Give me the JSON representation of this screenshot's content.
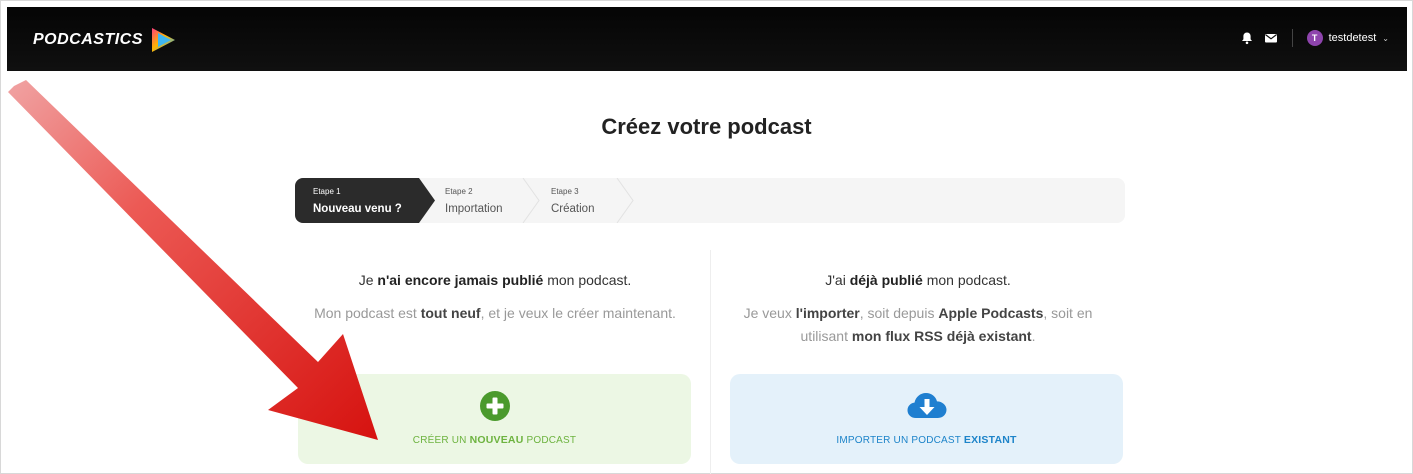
{
  "header": {
    "logo_text": "PODCASTICS",
    "notifications_icon": "bell-icon",
    "messages_icon": "envelope-icon",
    "avatar_initial": "T",
    "username": "testdetest",
    "caret": "⌄"
  },
  "page_title": "Créez votre podcast",
  "steps": [
    {
      "number": "Etape 1",
      "label": "Nouveau venu ?",
      "active": true
    },
    {
      "number": "Etape 2",
      "label": "Importation",
      "active": false
    },
    {
      "number": "Etape 3",
      "label": "Création",
      "active": false
    }
  ],
  "left_option": {
    "head_pre": "Je ",
    "head_bold": "n'ai encore jamais publié",
    "head_post": " mon podcast.",
    "sub_pre": "Mon podcast est ",
    "sub_bold": "tout neuf",
    "sub_post": ", et je veux le créer maintenant.",
    "button_icon": "plus-circle-icon",
    "button_pre": "CRÉER UN ",
    "button_bold": "NOUVEAU",
    "button_post": " PODCAST"
  },
  "right_option": {
    "head_pre": "J'ai ",
    "head_bold": "déjà publié",
    "head_post": " mon podcast.",
    "sub_pre": "Je veux ",
    "sub_bold1": "l'importer",
    "sub_mid1": ", soit depuis ",
    "sub_bold2": "Apple Podcasts",
    "sub_mid2": ", soit en utilisant ",
    "sub_bold3": "mon flux RSS déjà existant",
    "sub_post": ".",
    "button_icon": "cloud-download-icon",
    "button_pre": "IMPORTER UN PODCAST ",
    "button_bold": "EXISTANT"
  },
  "colors": {
    "topbar": "#0a0a0a",
    "green_accent": "#6db33f",
    "blue_accent": "#1d84c9",
    "annotation_arrow": "#e3231b"
  },
  "annotation": {
    "arrow_icon": "red-arrow-annotation"
  }
}
